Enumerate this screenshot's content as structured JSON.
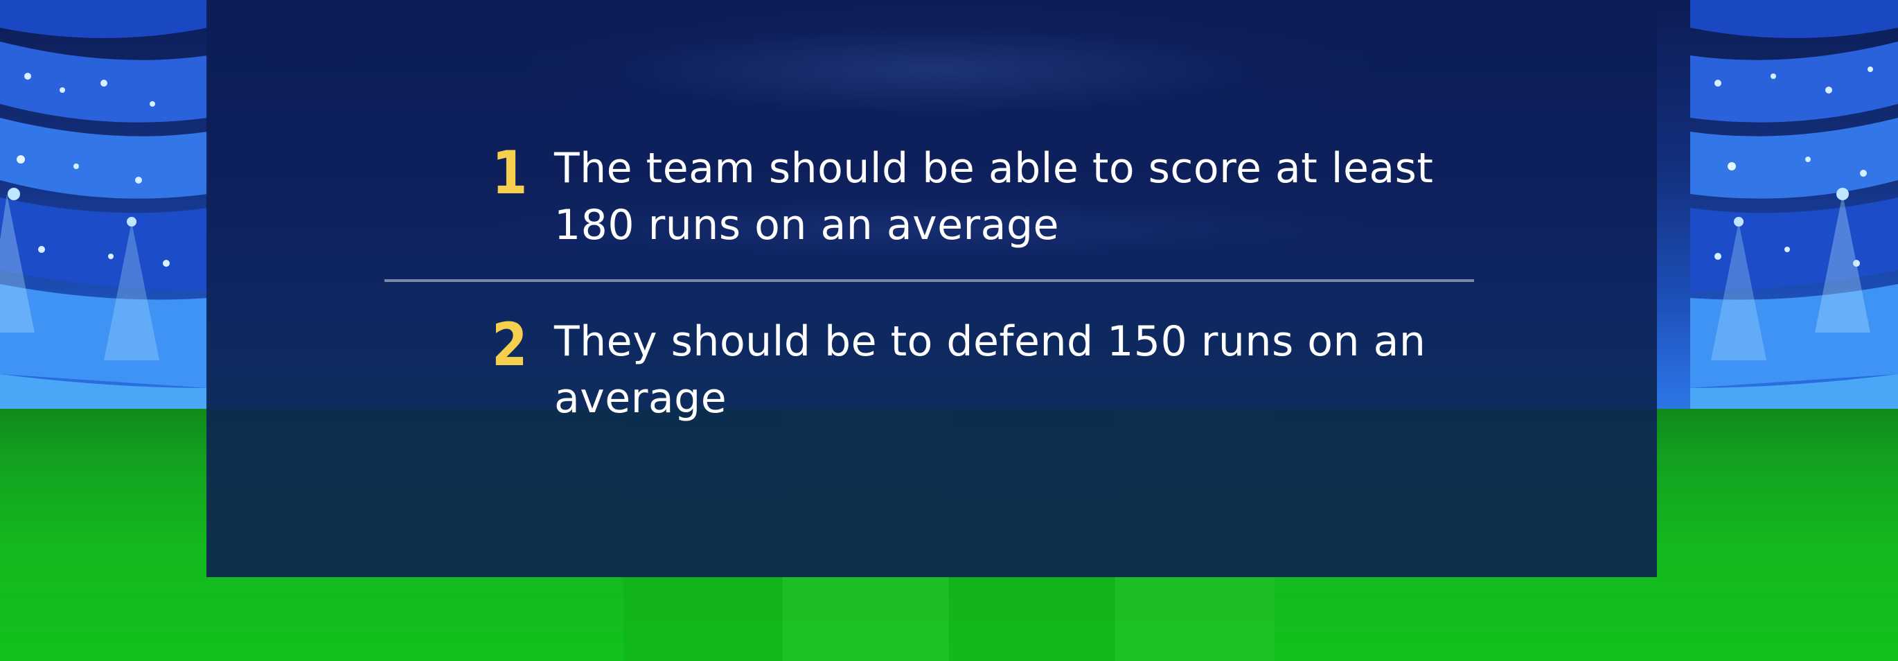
{
  "items": [
    {
      "number": "1",
      "text": "The team should be able to score at least 180 runs on an average"
    },
    {
      "number": "2",
      "text": "They should be to defend 150 runs on an average"
    }
  ],
  "colors": {
    "panel": "#0c1c56",
    "number": "#f6cf4e",
    "text": "#ffffff",
    "divider": "#8f9ab8",
    "field": "#14b81f",
    "stands": "#2a6fe0"
  },
  "icons": {
    "background": "stadium-illustration"
  }
}
